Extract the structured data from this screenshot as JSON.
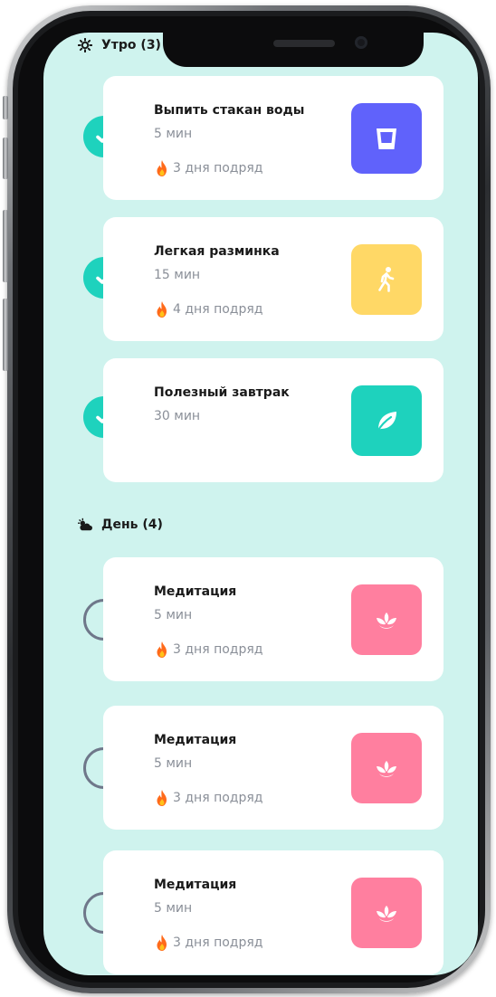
{
  "sections": [
    {
      "title": "Утро (3)",
      "icon": "sun-icon"
    },
    {
      "title": "День (4)",
      "icon": "cloud-sun-icon"
    }
  ],
  "habits": [
    {
      "title": "Выпить стакан воды",
      "duration": "5 мин",
      "streak": "3 дня подряд",
      "done": true,
      "icon": "glass-icon",
      "tile_color": "#6062fb"
    },
    {
      "title": "Легкая разминка",
      "duration": "15 мин",
      "streak": "4 дня подряд",
      "done": true,
      "icon": "walking-icon",
      "tile_color": "#ffd866"
    },
    {
      "title": "Полезный завтрак",
      "duration": "30 мин",
      "streak": "",
      "done": true,
      "icon": "leaf-icon",
      "tile_color": "#1ed2bd"
    },
    {
      "title": "Медитация",
      "duration": "5 мин",
      "streak": "3 дня подряд",
      "done": false,
      "icon": "lotus-icon",
      "tile_color": "#ff7f9f"
    },
    {
      "title": "Медитация",
      "duration": "5 мин",
      "streak": "3 дня подряд",
      "done": false,
      "icon": "lotus-icon",
      "tile_color": "#ff7f9f"
    },
    {
      "title": "Медитация",
      "duration": "5 мин",
      "streak": "3 дня подряд",
      "done": false,
      "icon": "lotus-icon",
      "tile_color": "#ff7f9f"
    }
  ],
  "colors": {
    "screen_bg": "#cff3ee",
    "check_done": "#1ed2bd",
    "check_todo_border": "#6f778a"
  }
}
